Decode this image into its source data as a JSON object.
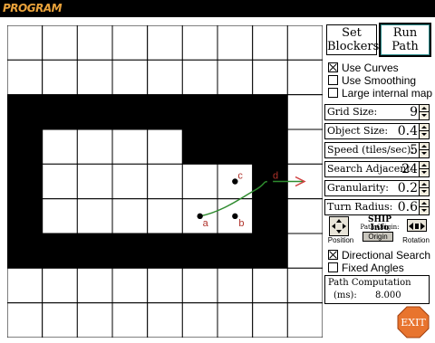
{
  "app": {
    "title": "PROGRAM"
  },
  "grid": {
    "cols": 9,
    "rows": 9,
    "blocked": [
      [
        0,
        0,
        0,
        0,
        0,
        0,
        0,
        0,
        0
      ],
      [
        0,
        0,
        0,
        0,
        0,
        0,
        0,
        0,
        0
      ],
      [
        1,
        1,
        1,
        1,
        1,
        1,
        1,
        1,
        0
      ],
      [
        1,
        0,
        0,
        0,
        0,
        1,
        1,
        1,
        0
      ],
      [
        1,
        0,
        0,
        0,
        0,
        0,
        0,
        1,
        0
      ],
      [
        1,
        0,
        0,
        0,
        0,
        0,
        0,
        1,
        0
      ],
      [
        1,
        1,
        1,
        1,
        1,
        1,
        1,
        1,
        0
      ],
      [
        0,
        0,
        0,
        0,
        0,
        0,
        0,
        0,
        0
      ],
      [
        0,
        0,
        0,
        0,
        0,
        0,
        0,
        0,
        0
      ]
    ],
    "markers": [
      {
        "label": "a",
        "col": 5.5,
        "row": 5.5
      },
      {
        "label": "b",
        "col": 6.5,
        "row": 5.5
      },
      {
        "label": "c",
        "col": 6.5,
        "row": 4.5
      },
      {
        "label": "d",
        "col": 7.5,
        "row": 4.5
      }
    ],
    "path_color": "#2e8b2e",
    "arrow_color": "#d04040",
    "label_color": "#b0322a"
  },
  "buttons": {
    "set_blockers_line1": "Set",
    "set_blockers_line2": "Blockers",
    "run_path_line1": "Run",
    "run_path_line2": "Path"
  },
  "options": {
    "use_curves": {
      "label": "Use Curves",
      "checked": true
    },
    "use_smoothing": {
      "label": "Use Smoothing",
      "checked": false
    },
    "large_internal_map": {
      "label": "Large internal map",
      "checked": false
    }
  },
  "params": [
    {
      "label": "Grid Size:",
      "value": "9"
    },
    {
      "label": "Object Size:",
      "value": "0.4"
    },
    {
      "label": "Speed (tiles/sec):",
      "value": "5"
    },
    {
      "label": "Search Adjacent:",
      "value": "24"
    },
    {
      "label": "Granularity:",
      "value": "0.2"
    },
    {
      "label": "Turn Radius:",
      "value": "0.6"
    }
  ],
  "ship": {
    "title": "SHIP Info",
    "subtitle": "Path Origin:",
    "position_label": "Position",
    "origin_label": "Origin",
    "rotation_label": "Rotation"
  },
  "search": {
    "directional": {
      "label": "Directional Search",
      "checked": true
    },
    "fixed_angles": {
      "label": "Fixed Angles",
      "checked": false
    }
  },
  "path_computation": {
    "title": "Path Computation",
    "unit": "(ms):",
    "value": "8.000"
  },
  "exit": {
    "label": "EXIT",
    "color": "#e8742e"
  }
}
